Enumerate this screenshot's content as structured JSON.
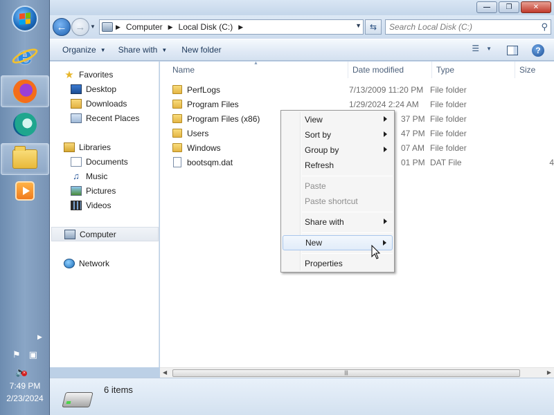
{
  "taskbar": {
    "items": [
      {
        "name": "start-button"
      },
      {
        "name": "internet-explorer"
      },
      {
        "name": "firefox"
      },
      {
        "name": "edge"
      },
      {
        "name": "windows-explorer"
      },
      {
        "name": "media-player"
      }
    ],
    "clock_time": "7:49 PM",
    "clock_date": "2/23/2024"
  },
  "window": {
    "caption_buttons": {
      "minimize": "—",
      "maximize": "❐",
      "close": "✕"
    },
    "breadcrumb": [
      "Computer",
      "Local Disk (C:)"
    ],
    "search_placeholder": "Search Local Disk (C:)",
    "toolbar": {
      "organize": "Organize",
      "share_with": "Share with",
      "new_folder": "New folder"
    }
  },
  "navpane": {
    "favorites_header": "Favorites",
    "favorites": [
      "Desktop",
      "Downloads",
      "Recent Places"
    ],
    "libraries_header": "Libraries",
    "libraries": [
      "Documents",
      "Music",
      "Pictures",
      "Videos"
    ],
    "computer": "Computer",
    "network": "Network"
  },
  "filelist": {
    "columns": {
      "name": "Name",
      "date": "Date modified",
      "type": "Type",
      "size": "Size"
    },
    "rows": [
      {
        "name": "PerfLogs",
        "date": "7/13/2009 11:20 PM",
        "type": "File folder",
        "size": "",
        "kind": "folder"
      },
      {
        "name": "Program Files",
        "date": "1/29/2024 2:24 AM",
        "type": "File folder",
        "size": "",
        "kind": "folder"
      },
      {
        "name": "Program Files (x86)",
        "date": "37 PM",
        "type": "File folder",
        "size": "",
        "kind": "folder"
      },
      {
        "name": "Users",
        "date": "47 PM",
        "type": "File folder",
        "size": "",
        "kind": "folder"
      },
      {
        "name": "Windows",
        "date": "07 AM",
        "type": "File folder",
        "size": "",
        "kind": "folder"
      },
      {
        "name": "bootsqm.dat",
        "date": "01 PM",
        "type": "DAT File",
        "size": "4",
        "kind": "file"
      }
    ]
  },
  "details": {
    "item_count": "6 items"
  },
  "context_menu": {
    "view": "View",
    "sort_by": "Sort by",
    "group_by": "Group by",
    "refresh": "Refresh",
    "paste": "Paste",
    "paste_shortcut": "Paste shortcut",
    "share_with": "Share with",
    "new": "New",
    "properties": "Properties"
  }
}
